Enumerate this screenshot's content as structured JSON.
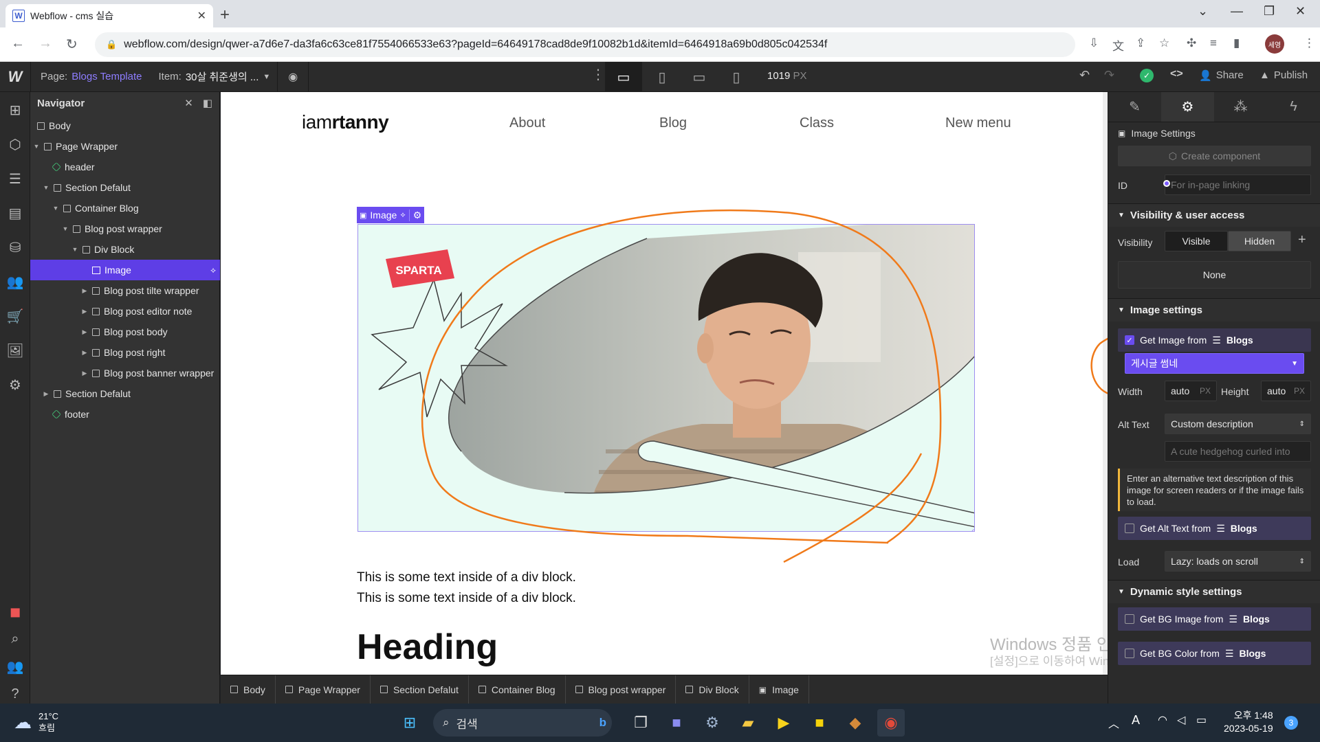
{
  "browser": {
    "tab_title": "Webflow - cms 실습",
    "favicon": "W",
    "url": "webflow.com/design/qwer-a7d6e7-da3fa6c63ce81f7554066533e63?pageId=64649178cad8de9f10082b1d&itemId=6464918a69b0d805c042534f",
    "profile": "세영"
  },
  "topbar": {
    "page_label": "Page:",
    "page_name": "Blogs Template",
    "item_label": "Item:",
    "item_value": "30살 취준생의 ...",
    "width_value": "1019",
    "width_unit": "PX",
    "share": "Share",
    "publish": "Publish"
  },
  "navigator": {
    "title": "Navigator",
    "nodes": [
      {
        "label": "Body"
      },
      {
        "label": "Page Wrapper"
      },
      {
        "label": "header"
      },
      {
        "label": "Section Defalut"
      },
      {
        "label": "Container Blog"
      },
      {
        "label": "Blog post wrapper"
      },
      {
        "label": "Div Block"
      },
      {
        "label": "Image"
      },
      {
        "label": "Blog post tilte wrapper"
      },
      {
        "label": "Blog post editor note"
      },
      {
        "label": "Blog post body"
      },
      {
        "label": "Blog post right"
      },
      {
        "label": "Blog post banner wrapper"
      },
      {
        "label": "Section Defalut"
      },
      {
        "label": "footer"
      }
    ]
  },
  "canvas": {
    "logo_light": "iam",
    "logo_bold": "rtanny",
    "menu": [
      "About",
      "Blog",
      "Class",
      "New menu"
    ],
    "image_tag": "Image",
    "sparta_badge": "SPARTA",
    "paragraph": [
      "This is some text inside of a div block.",
      "This is some text inside of a div block."
    ],
    "heading": "Heading"
  },
  "breadcrumb": [
    "Body",
    "Page Wrapper",
    "Section Defalut",
    "Container Blog",
    "Blog post wrapper",
    "Div Block",
    "Image"
  ],
  "settings": {
    "panel_title": "Image Settings",
    "create_component": "Create component",
    "id_label": "ID",
    "id_placeholder": "For in-page linking",
    "visibility_section": "Visibility & user access",
    "visibility_label": "Visibility",
    "visible": "Visible",
    "hidden": "Hidden",
    "none": "None",
    "image_settings_section": "Image settings",
    "get_image_from": "Get Image from",
    "collection": "Blogs",
    "bound_field": "게시글 썸네",
    "width_label": "Width",
    "width_value": "auto",
    "height_label": "Height",
    "height_value": "auto",
    "unit": "PX",
    "alt_label": "Alt Text",
    "alt_value": "Custom description",
    "alt_placeholder": "A cute hedgehog curled into",
    "alt_help": "Enter an alternative text description of this image for screen readers or if the image fails to load.",
    "get_alt_text_from": "Get Alt Text from",
    "load_label": "Load",
    "load_value": "Lazy: loads on scroll",
    "dynamic_section": "Dynamic style settings",
    "get_bg_image_from": "Get BG Image from",
    "get_bg_color_from": "Get BG Color from"
  },
  "watermark": {
    "line1": "Windows 정품 인증",
    "line2": "[설정]으로 이동하여 Windows를 정품 인증합니다."
  },
  "taskbar": {
    "temperature": "21°C",
    "weather": "흐림",
    "search_placeholder": "검색",
    "time": "오후 1:48",
    "date": "2023-05-19",
    "notification_count": "3"
  },
  "colors": {
    "accent": "#5e3ee6",
    "annotation": "#f07a1a",
    "image_bg": "#e8fbf4"
  }
}
